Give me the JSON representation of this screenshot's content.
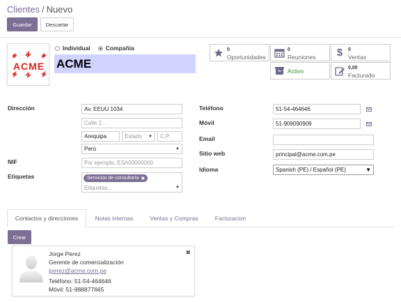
{
  "breadcrumb": {
    "parent": "Clientes",
    "separator": "/",
    "current": "Nuevo"
  },
  "buttons": {
    "save": "Guardar",
    "discard": "Descartar",
    "create": "Crear"
  },
  "company_type": {
    "individual": "Individual",
    "company": "Compañía",
    "selected": "company"
  },
  "partner": {
    "name": "ACME",
    "logo_text": "ACME"
  },
  "smart_buttons": [
    {
      "icon": "star-icon",
      "count": "0",
      "label": "Oportunidades"
    },
    {
      "icon": "calendar-icon",
      "count": "0",
      "label": "Reuniones"
    },
    {
      "icon": "dollar-icon",
      "count": "0",
      "label": "Ventas"
    },
    {
      "icon": "archive-icon",
      "count": "",
      "label": "Activo"
    },
    {
      "icon": "invoice-edit-icon",
      "count": "0,00",
      "label": "Facturado"
    }
  ],
  "address": {
    "label": "Dirección",
    "street": "Av. EEUU 1034",
    "street2_placeholder": "Calle 2...",
    "city": "Arequipa",
    "state_placeholder": "Estado",
    "zip_placeholder": "C.P.",
    "country": "Perú"
  },
  "vat": {
    "label": "NIF",
    "placeholder": "Por ejemplo, ESA00000000"
  },
  "tags": {
    "label": "Etiquetas",
    "items": [
      "Servicios de consultoría"
    ],
    "placeholder": "Etiquetas..."
  },
  "contact": {
    "phone_label": "Teléfono",
    "phone": "51-54-464646",
    "mobile_label": "Móvil",
    "mobile": "51-909090909",
    "email_label": "Email",
    "email": "",
    "website_label": "Sitio web",
    "website": "principal@acme.com.pe",
    "lang_label": "Idioma",
    "lang": "Spanish (PE) / Español (PE)"
  },
  "tabs": [
    "Contactos y direcciones",
    "Notas internas",
    "Ventas y Compras",
    "Facturacion"
  ],
  "active_tab": 0,
  "contact_card": {
    "name": "Jorge Perez",
    "function": "Gerente de comercialización",
    "email": "jperez@acme.com.pe",
    "phone": "Teléfono: 51-54-464646",
    "mobile": "Móvil: 51-988877665"
  },
  "colors": {
    "brand": "#7c6f94",
    "required_field": "#d2d2ff",
    "logo_red": "#d9231d"
  }
}
